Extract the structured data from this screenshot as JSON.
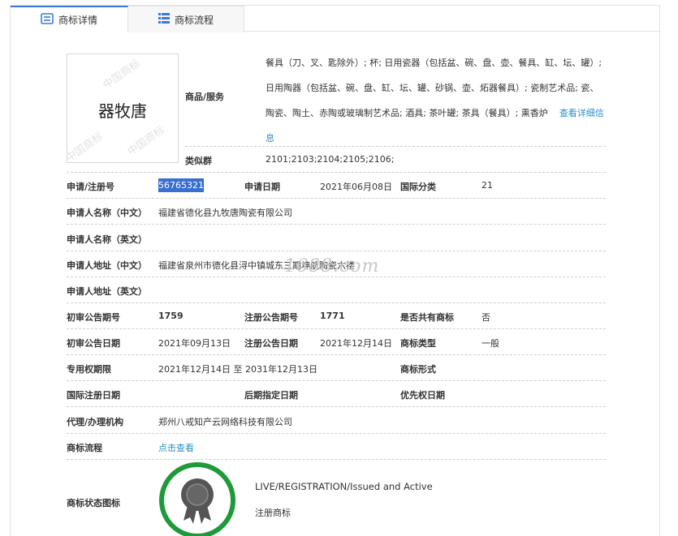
{
  "tabs": [
    {
      "label": "商标详情",
      "icon": "document-list-icon",
      "active": true
    },
    {
      "label": "商标流程",
      "icon": "grid-list-icon",
      "active": false
    }
  ],
  "logo": {
    "text": "器牧唐",
    "watermark": "中国商标"
  },
  "goods": {
    "label": "商品/服务",
    "lines": [
      "餐具（刀、叉、匙除外）; 杯; 日用瓷器（包括盆、碗、盘、壶、餐具、缸、坛、罐）;",
      "日用陶器（包括盆、碗、盘、缸、坛、罐、砂锅、壶、炻器餐具）; 瓷制艺术品; 瓷、",
      "陶瓷、陶土、赤陶或玻璃制艺术品; 酒具; 茶叶罐; 茶具（餐具）; 熏香炉"
    ],
    "more_link": "查看详细信",
    "more_link_tail": "息"
  },
  "similar_group": {
    "label": "类似群",
    "value": "2101;2103;2104;2105;2106;"
  },
  "app": {
    "reg_no_label": "申请/注册号",
    "reg_no": "56765321",
    "date_label": "申请日期",
    "date": "2021年06月08日",
    "intl_class_label": "国际分类",
    "intl_class": "21"
  },
  "applicant_cn": {
    "label": "申请人名称（中文）",
    "value": "福建省德化县九牧唐陶瓷有限公司"
  },
  "applicant_en": {
    "label": "申请人名称（英文）",
    "value": ""
  },
  "address_cn": {
    "label": "申请人地址（中文）",
    "value": "福建省泉州市德化县浔中镇城东三期坤航陶瓷六楼"
  },
  "address_en": {
    "label": "申请人地址（英文）",
    "value": ""
  },
  "prelim": {
    "issue_label": "初审公告期号",
    "issue": "1759",
    "reg_issue_label": "注册公告期号",
    "reg_issue": "1771",
    "shared_label": "是否共有商标",
    "shared": "否"
  },
  "dates": {
    "prelim_date_label": "初审公告日期",
    "prelim_date": "2021年09月13日",
    "reg_date_label": "注册公告日期",
    "reg_date": "2021年12月14日",
    "type_label": "商标类型",
    "type": "一般"
  },
  "exclusive": {
    "label": "专用权期限",
    "value": "2021年12月14日 至 2031年12月13日",
    "form_label": "商标形式",
    "form": ""
  },
  "intl": {
    "reg_date_label": "国际注册日期",
    "reg_date": "",
    "later_label": "后期指定日期",
    "later": "",
    "priority_label": "优先权日期",
    "priority": ""
  },
  "agent": {
    "label": "代理/办理机构",
    "value": "郑州八戒知产云网络科技有限公司"
  },
  "flow": {
    "label": "商标流程",
    "link": "点击查看"
  },
  "status": {
    "label": "商标状态图标",
    "en": "LIVE/REGISTRATION/Issued and Active",
    "cn": "注册商标",
    "icon": "registered-badge-icon",
    "ring_color": "#1f9a3a"
  },
  "watermark_site": "1688.com",
  "colors": {
    "accent": "#3a7bd5",
    "link": "#2a8fc9",
    "highlight": "#3a6fd0"
  }
}
